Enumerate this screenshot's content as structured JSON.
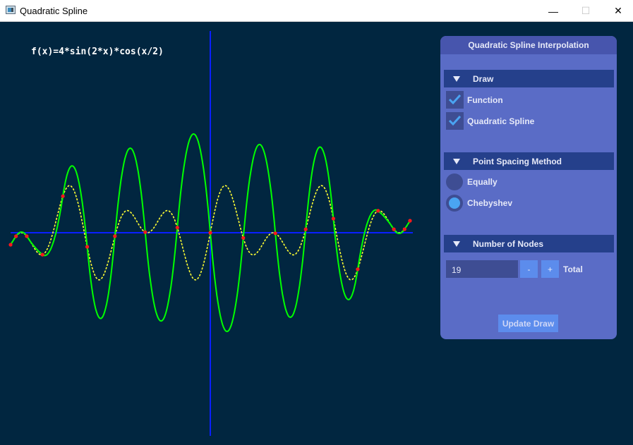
{
  "window": {
    "title": "Quadratic Spline",
    "minimize_glyph": "—",
    "maximize_glyph": "☐",
    "close_glyph": "✕"
  },
  "plot": {
    "formula": "f(x)=4*sin(2*x)*cos(x/2)",
    "colors": {
      "background": "#012640",
      "axes": "#0a1fff",
      "function": "#ffff33",
      "spline": "#00ff00",
      "nodes": "#ff1a1a"
    }
  },
  "panel": {
    "title": "Quadratic Spline Interpolation",
    "draw_section": {
      "label": "Draw",
      "function_label": "Function",
      "function_checked": true,
      "spline_label": "Quadratic Spline",
      "spline_checked": true
    },
    "spacing_section": {
      "label": "Point Spacing Method",
      "equally_label": "Equally",
      "chebyshev_label": "Chebyshev",
      "selected": "Chebyshev"
    },
    "nodes_section": {
      "label": "Number of Nodes",
      "value": "19",
      "minus_label": "-",
      "plus_label": "+",
      "total_label": "Total"
    },
    "update_label": "Update Draw"
  }
}
